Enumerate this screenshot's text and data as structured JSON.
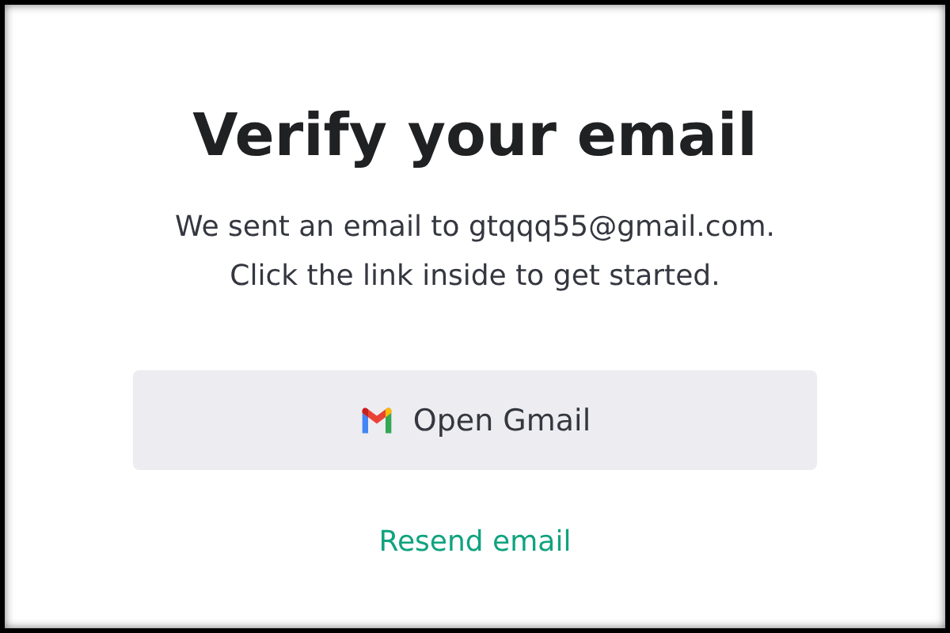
{
  "title": "Verify your email",
  "message": [
    "We sent an email to gtqqq55@gmail.com.",
    "Click the link inside to get started."
  ],
  "button": {
    "label": "Open Gmail"
  },
  "link": "Resend email"
}
